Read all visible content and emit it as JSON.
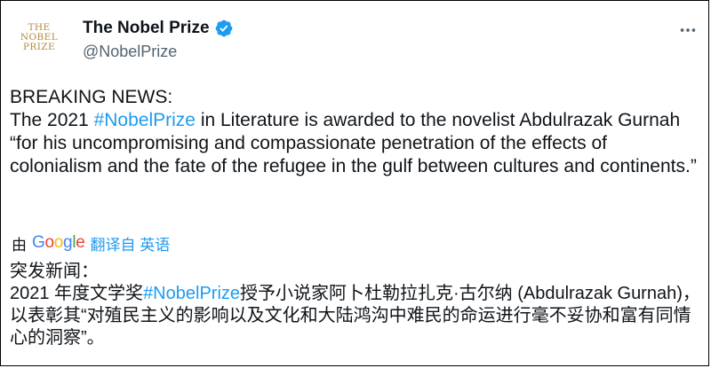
{
  "author": {
    "display_name": "The Nobel Prize",
    "handle": "@NobelPrize",
    "avatar_lines": [
      "THE",
      "NOBEL",
      "PRIZE"
    ],
    "verified": true,
    "avatar_color": "#b38a3f",
    "verified_color": "#1d9bf0"
  },
  "menu": {
    "icon": "more-icon"
  },
  "tweet": {
    "line1": "BREAKING NEWS:",
    "part1": "The 2021 ",
    "hashtag": "#NobelPrize",
    "part2": " in Literature is awarded to the novelist Abdulrazak Gurnah “for his uncompromising and compassionate penetration of the effects of colonialism and the fate of the refugee in the gulf between cultures and continents.”"
  },
  "translation": {
    "by": "由",
    "google_letters": [
      "G",
      "o",
      "o",
      "g",
      "l",
      "e"
    ],
    "google_colors": [
      "#4285F4",
      "#EA4335",
      "#FBBC05",
      "#4285F4",
      "#34A853",
      "#EA4335"
    ],
    "link": "翻译自 英语",
    "line1": "突发新闻：",
    "part1": "2021 年度文学奖",
    "hashtag": "#NobelPrize",
    "part2": "授予小说家阿卜杜勒拉扎克·古尔纳 (Abdulrazak Gurnah)，以表彰其“对殖民主义的影响以及文化和大陆鸿沟中难民的命运进行毫不妥协和富有同情心的洞察”。"
  },
  "colors": {
    "text": "#0f1419",
    "secondary": "#536471",
    "link": "#1d9bf0"
  }
}
